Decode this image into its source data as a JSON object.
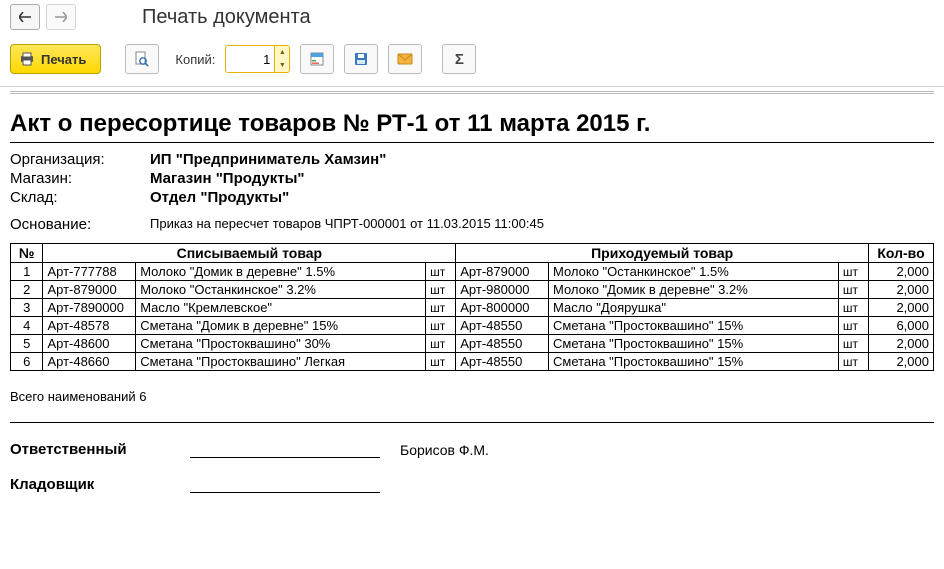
{
  "window": {
    "title": "Печать документа"
  },
  "toolbar": {
    "print_label": "Печать",
    "copies_label": "Копий:",
    "copies_value": "1"
  },
  "doc": {
    "title": "Акт о пересортице товаров № РТ-1 от 11 марта 2015 г.",
    "org_label": "Организация:",
    "org_value": "ИП \"Предприниматель Хамзин\"",
    "store_label": "Магазин:",
    "store_value": "Магазин \"Продукты\"",
    "warehouse_label": "Склад:",
    "warehouse_value": "Отдел \"Продукты\"",
    "basis_label": "Основание:",
    "basis_value": "Приказ на пересчет товаров ЧПРТ-000001 от 11.03.2015 11:00:45",
    "table": {
      "head_num": "№",
      "head_out": "Списываемый товар",
      "head_in": "Приходуемый товар",
      "head_qty": "Кол-во",
      "rows": [
        {
          "n": "1",
          "out_art": "Арт-777788",
          "out_name": "Молоко \"Домик в деревне\" 1.5%",
          "out_unit": "шт",
          "in_art": "Арт-879000",
          "in_name": "Молоко \"Останкинское\" 1.5%",
          "in_unit": "шт",
          "qty": "2,000"
        },
        {
          "n": "2",
          "out_art": "Арт-879000",
          "out_name": "Молоко \"Останкинское\" 3.2%",
          "out_unit": "шт",
          "in_art": "Арт-980000",
          "in_name": "Молоко \"Домик в деревне\" 3.2%",
          "in_unit": "шт",
          "qty": "2,000"
        },
        {
          "n": "3",
          "out_art": "Арт-7890000",
          "out_name": "Масло \"Кремлевское\"",
          "out_unit": "шт",
          "in_art": "Арт-800000",
          "in_name": "Масло \"Доярушка\"",
          "in_unit": "шт",
          "qty": "2,000"
        },
        {
          "n": "4",
          "out_art": "Арт-48578",
          "out_name": "Сметана \"Домик в деревне\" 15%",
          "out_unit": "шт",
          "in_art": "Арт-48550",
          "in_name": "Сметана \"Простоквашино\" 15%",
          "in_unit": "шт",
          "qty": "6,000"
        },
        {
          "n": "5",
          "out_art": "Арт-48600",
          "out_name": "Сметана \"Простоквашино\" 30%",
          "out_unit": "шт",
          "in_art": "Арт-48550",
          "in_name": "Сметана \"Простоквашино\" 15%",
          "in_unit": "шт",
          "qty": "2,000"
        },
        {
          "n": "6",
          "out_art": "Арт-48660",
          "out_name": "Сметана \"Простоквашино\" Легкая",
          "out_unit": "шт",
          "in_art": "Арт-48550",
          "in_name": "Сметана \"Простоквашино\" 15%",
          "in_unit": "шт",
          "qty": "2,000"
        }
      ]
    },
    "totals_text": "Всего наименований 6",
    "sign_responsible_label": "Ответственный",
    "sign_responsible_name": "Борисов Ф.М.",
    "sign_storekeeper_label": "Кладовщик"
  }
}
